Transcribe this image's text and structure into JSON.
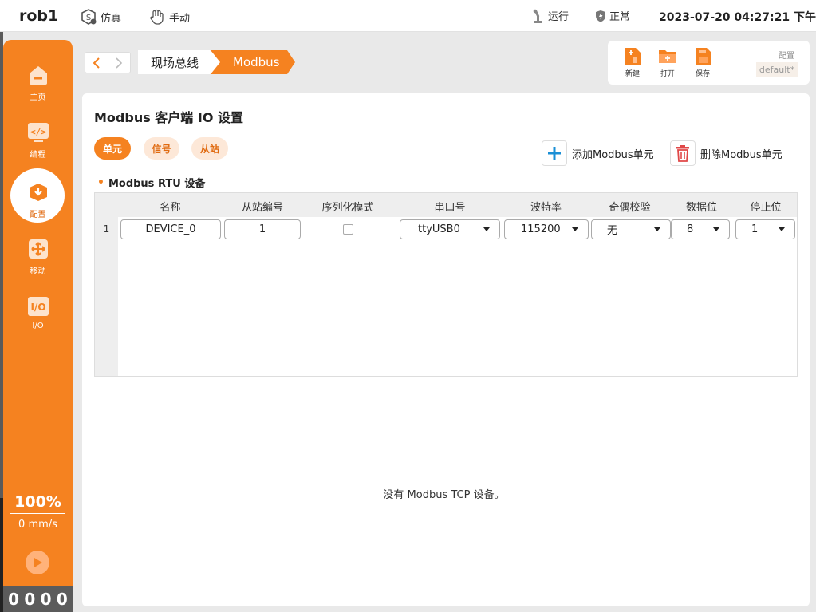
{
  "topbar": {
    "robot_name": "rob1",
    "sim_label": "仿真",
    "manual_label": "手动",
    "run_label": "运行",
    "status_label": "正常",
    "datetime": "2023-07-20 04:27:21 下午"
  },
  "sidebar": {
    "items": [
      {
        "label": "主页",
        "icon": "home-icon"
      },
      {
        "label": "编程",
        "icon": "code-icon"
      },
      {
        "label": "配置",
        "icon": "config-icon"
      },
      {
        "label": "移动",
        "icon": "move-icon"
      },
      {
        "label": "I/O",
        "icon": "io-icon"
      }
    ],
    "speed_percent": "100%",
    "speed_value": "0 mm/s",
    "counter": [
      "0",
      "0",
      "0",
      "0"
    ]
  },
  "breadcrumb": {
    "items": [
      "现场总线",
      "Modbus"
    ]
  },
  "toolbar": {
    "new_label": "新建",
    "open_label": "打开",
    "save_label": "保存",
    "config_label": "配置",
    "config_value": "default*"
  },
  "main": {
    "title": "Modbus 客户端 IO 设置",
    "tabs": [
      "单元",
      "信号",
      "从站"
    ],
    "add_label": "添加Modbus单元",
    "delete_label": "删除Modbus单元",
    "section_title": "Modbus RTU 设备",
    "table": {
      "headers": [
        "名称",
        "从站编号",
        "序列化模式",
        "串口号",
        "波特率",
        "奇偶校验",
        "数据位",
        "停止位"
      ],
      "rows": [
        {
          "index": "1",
          "name": "DEVICE_0",
          "slave_id": "1",
          "serialize": false,
          "port": "ttyUSB0",
          "baud": "115200",
          "parity": "无",
          "data_bits": "8",
          "stop_bits": "1"
        }
      ]
    },
    "tcp_empty_message": "没有 Modbus TCP 设备。"
  },
  "colors": {
    "accent": "#f58220",
    "accent_light": "#fde8d8",
    "panel_bg": "#ffffff",
    "page_bg": "#e9e9e9"
  }
}
